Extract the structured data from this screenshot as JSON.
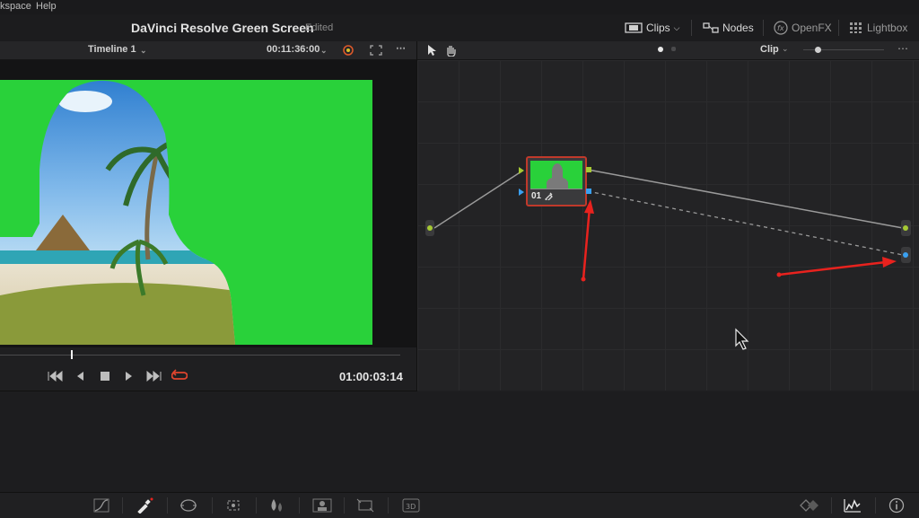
{
  "menubar": {
    "items": [
      "kspace",
      "Help"
    ]
  },
  "titlebar": {
    "title": "DaVinci Resolve Green Screen",
    "status": "Edited",
    "buttons": {
      "clips": "Clips",
      "nodes": "Nodes",
      "openfx": "OpenFX",
      "lightbox": "Lightbox"
    }
  },
  "viewer": {
    "timeline_name": "Timeline 1",
    "duration": "00:11:36:00",
    "timecode": "01:00:03:14"
  },
  "node_editor": {
    "mode": "Clip",
    "node": {
      "label": "01"
    }
  },
  "colors": {
    "green_screen": "#29d13a",
    "annotation": "#e8221e",
    "node_border": "#c0392b",
    "rgb_port": "#a6c934",
    "alpha_port": "#3aa0f0"
  },
  "icons": {
    "bottombar": [
      "curves-icon",
      "qualifier-eyedropper-icon",
      "window-icon",
      "tracker-icon",
      "blur-icon",
      "key-icon",
      "sizing-icon",
      "3d-icon",
      "keyframes-icon",
      "scopes-icon",
      "info-icon"
    ]
  }
}
